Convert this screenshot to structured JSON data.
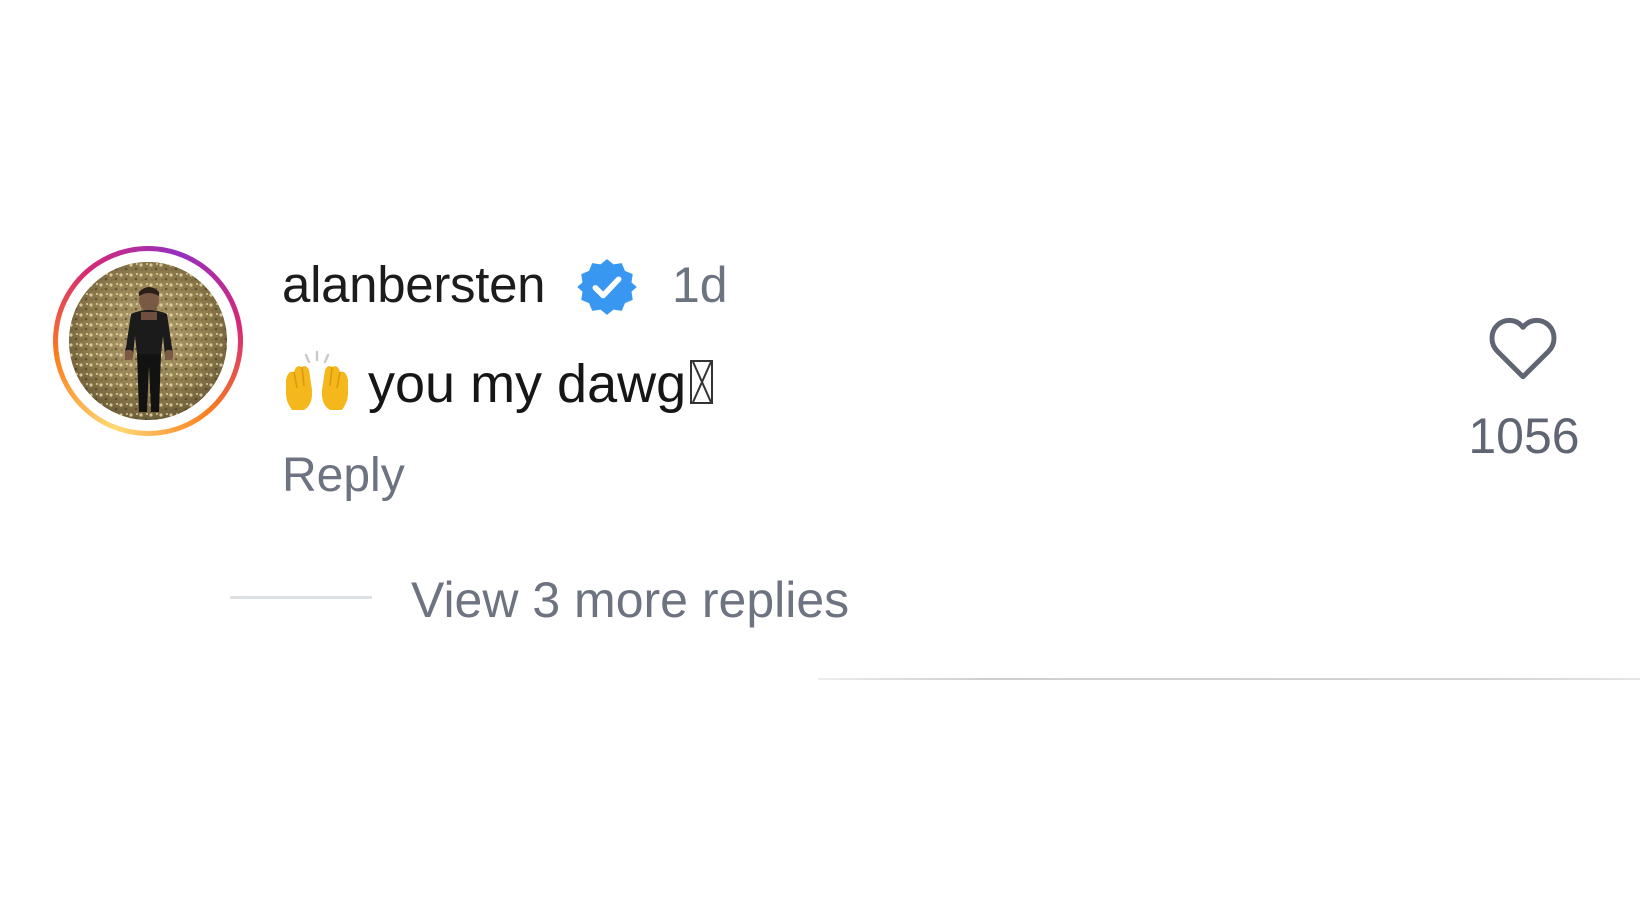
{
  "comment": {
    "username": "alanbersten",
    "verified": true,
    "timestamp": "1d",
    "text": "you my dawg",
    "leading_emoji": "raising-hands-emoji",
    "trailing_glyph": "missing-glyph",
    "reply_label": "Reply",
    "likes": {
      "count": "1056",
      "icon": "heart-icon"
    },
    "view_replies_label": "View 3 more replies"
  },
  "colors": {
    "verified_badge": "#3897f0",
    "secondary_text": "#6d7380",
    "primary_text": "#161616",
    "story_ring": [
      "#feda75",
      "#fa7e1e",
      "#d62976",
      "#962fbf"
    ]
  }
}
